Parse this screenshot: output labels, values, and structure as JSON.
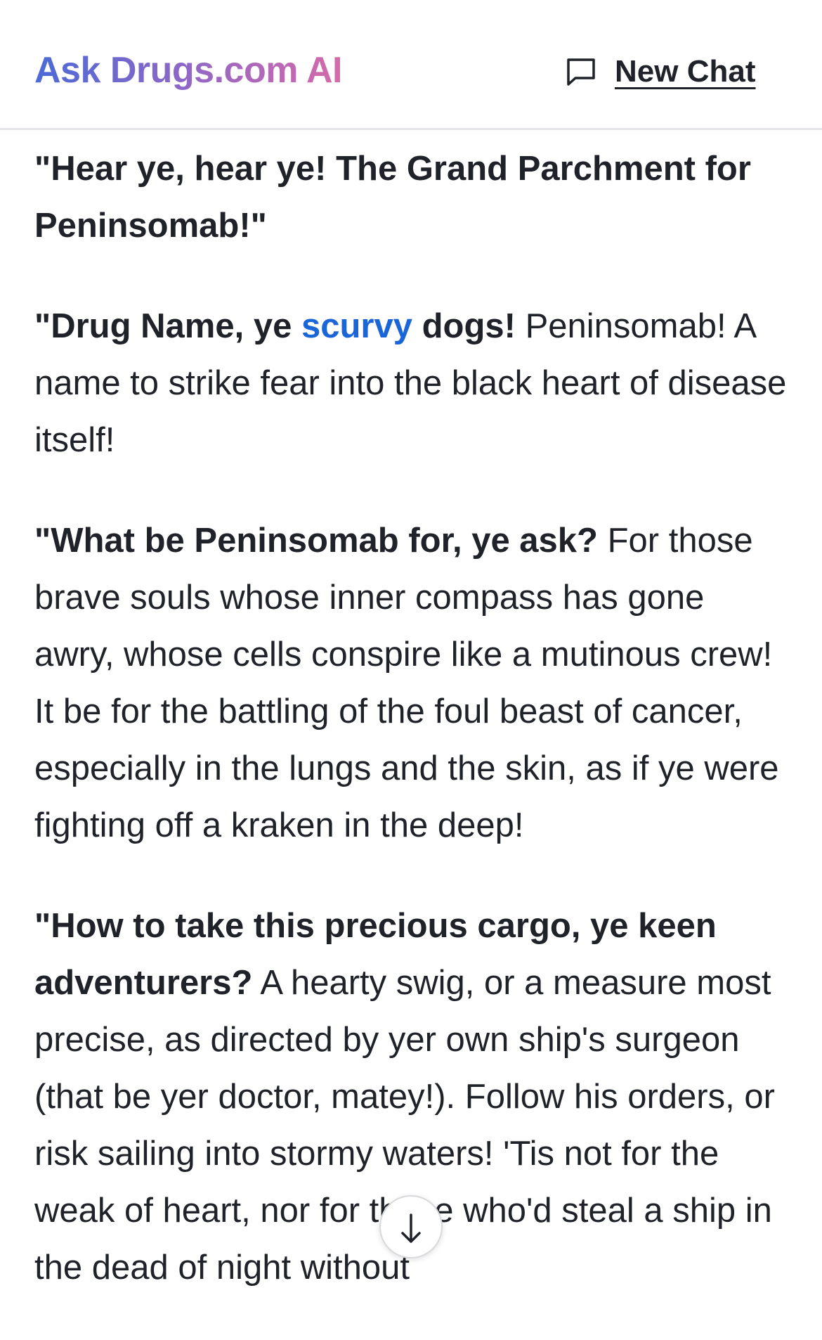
{
  "header": {
    "logo": "Ask Drugs.com AI",
    "new_chat_label": "New Chat",
    "new_chat_icon": "chat-bubble-icon"
  },
  "message": {
    "title": "\"Hear ye, hear ye! The Grand Parchment for Peninsomab!\"",
    "p1_bold_a": "\"Drug Name, ye ",
    "p1_link": "scurvy",
    "p1_bold_b": " dogs!",
    "p1_text": " Peninsomab! A name to strike fear into the black heart of disease itself!",
    "p2_bold": "\"What be Peninsomab for, ye ask?",
    "p2_text": " For those brave souls whose inner compass has gone awry, whose cells conspire like a mutinous crew! It be for the battling of the foul beast of cancer, especially in the lungs and the skin, as if ye were fighting off a kraken in the deep!",
    "p3_bold": "\"How to take this precious cargo, ye keen adventurers?",
    "p3_text": " A hearty swig, or a measure most precise, as directed by yer own ship's surgeon (that be yer doctor, matey!). Follow his orders, or risk sailing into stormy waters! 'Tis not for the weak of heart, nor for those who'd steal a ship in the dead of night without"
  },
  "scroll_button": {
    "icon": "arrow-down-icon"
  }
}
